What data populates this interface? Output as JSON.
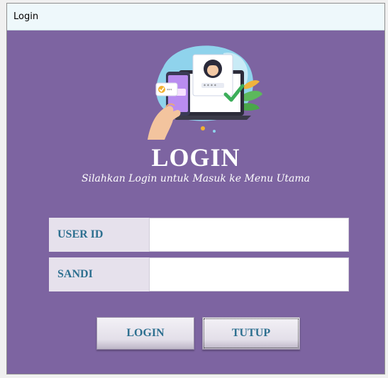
{
  "window": {
    "title": "Login"
  },
  "main": {
    "heading": "LOGIN",
    "subheading": "Silahkan Login untuk Masuk ke Menu Utama",
    "illustration": "login-illustration"
  },
  "form": {
    "userid_label": "USER ID",
    "userid_value": "",
    "password_label": "SANDI",
    "password_value": ""
  },
  "buttons": {
    "login_label": "LOGIN",
    "close_label": "TUTUP"
  },
  "colors": {
    "background": "#7d64a1",
    "label_background": "#e6e1ec",
    "label_text": "#2e7090",
    "titlebar": "#eef8fb"
  }
}
